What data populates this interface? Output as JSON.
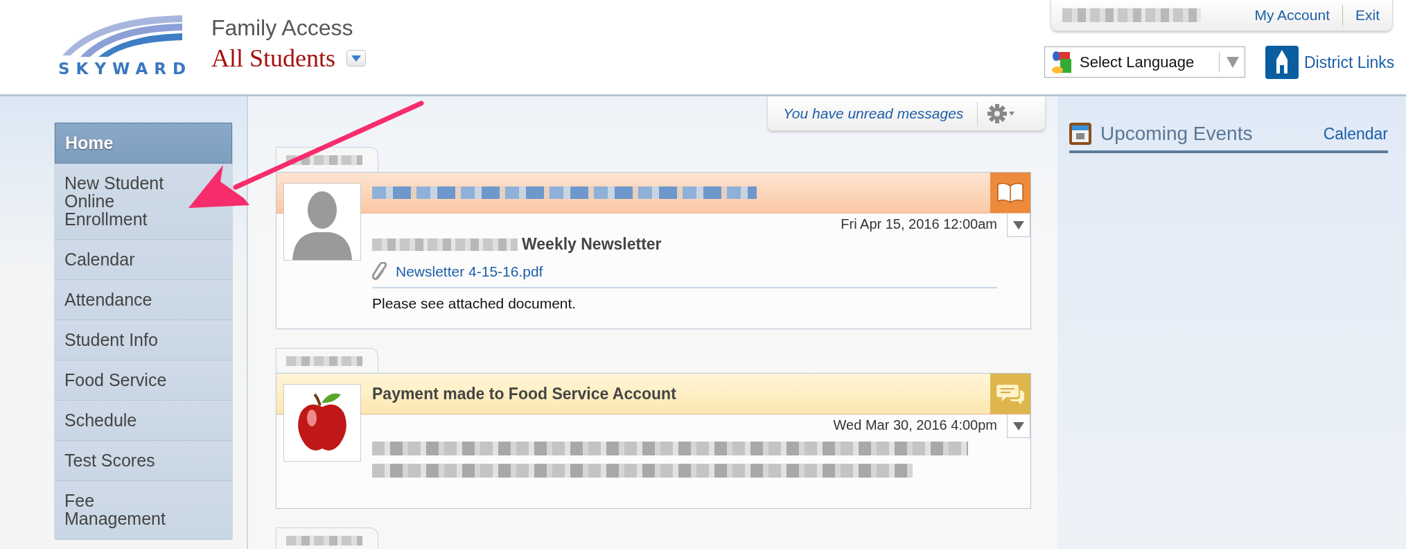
{
  "header": {
    "logo": "SKYWARD",
    "app_title": "Family Access",
    "student_selector": "All Students",
    "account_links": [
      "My Account",
      "Exit"
    ],
    "language_select": "Select Language",
    "district_links": "District Links"
  },
  "sidebar": {
    "items": [
      {
        "label": "Home",
        "selected": true
      },
      {
        "label": "New Student Online Enrollment",
        "selected": false
      },
      {
        "label": "Calendar",
        "selected": false
      },
      {
        "label": "Attendance",
        "selected": false
      },
      {
        "label": "Student Info",
        "selected": false
      },
      {
        "label": "Food Service",
        "selected": false
      },
      {
        "label": "Schedule",
        "selected": false
      },
      {
        "label": "Test Scores",
        "selected": false
      },
      {
        "label": "Fee Management",
        "selected": false
      }
    ]
  },
  "messages_bar": {
    "text": "You have unread messages"
  },
  "messages": [
    {
      "kind": "newsletter",
      "subject": "Weekly Newsletter",
      "date": "Fri Apr 15, 2016 12:00am",
      "attachment": "Newsletter 4-15-16.pdf",
      "body": "Please see attached document."
    },
    {
      "kind": "payment",
      "title": "Payment made to Food Service Account",
      "date": "Wed Mar 30, 2016 4:00pm"
    }
  ],
  "events": {
    "title": "Upcoming Events",
    "link": "Calendar"
  }
}
